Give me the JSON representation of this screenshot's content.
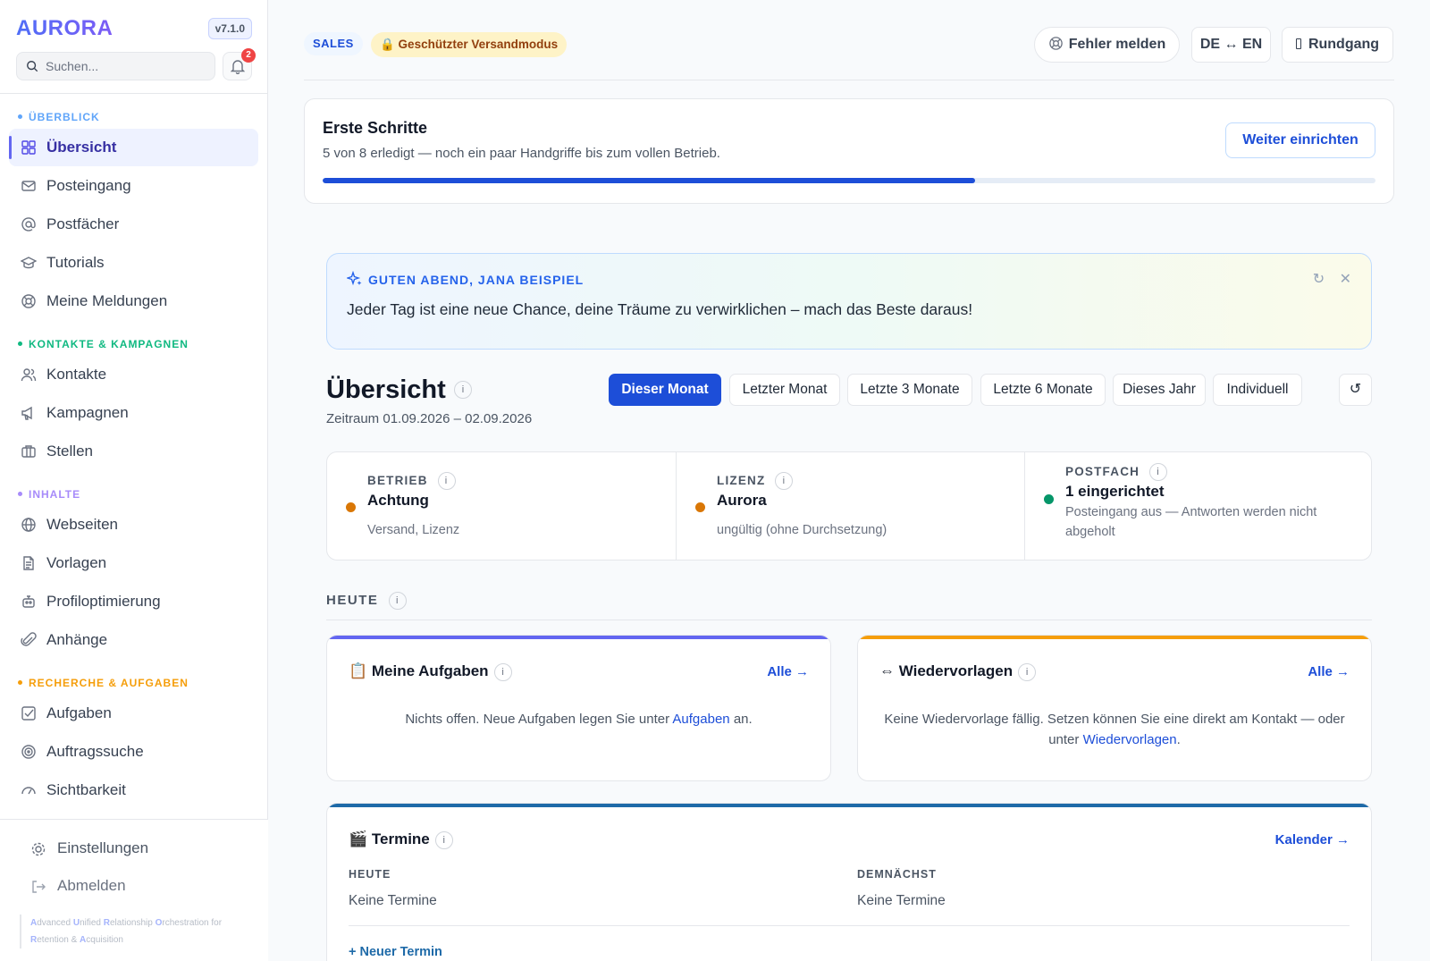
{
  "app": {
    "logo": "AURORA",
    "version": "v7.1.0"
  },
  "search": {
    "placeholder": "Suchen..."
  },
  "notifications": {
    "count": "2"
  },
  "sidebar": {
    "sections": [
      {
        "title": "ÜBERBLICK",
        "color": "#60a5fa",
        "items": [
          {
            "label": "Übersicht",
            "icon": "dashboard-icon",
            "active": true
          },
          {
            "label": "Posteingang",
            "icon": "mail-icon"
          },
          {
            "label": "Postfächer",
            "icon": "at-icon"
          },
          {
            "label": "Tutorials",
            "icon": "graduation-cap-icon"
          },
          {
            "label": "Meine Meldungen",
            "icon": "lifebuoy-icon"
          }
        ]
      },
      {
        "title": "KONTAKTE & KAMPAGNEN",
        "color": "#10b981",
        "items": [
          {
            "label": "Kontakte",
            "icon": "users-icon"
          },
          {
            "label": "Kampagnen",
            "icon": "megaphone-icon"
          },
          {
            "label": "Stellen",
            "icon": "briefcase-icon"
          }
        ]
      },
      {
        "title": "INHALTE",
        "color": "#a78bfa",
        "items": [
          {
            "label": "Webseiten",
            "icon": "globe-icon"
          },
          {
            "label": "Vorlagen",
            "icon": "document-icon"
          },
          {
            "label": "Profiloptimierung",
            "icon": "robot-icon"
          },
          {
            "label": "Anhänge",
            "icon": "paperclip-icon"
          }
        ]
      },
      {
        "title": "RECHERCHE & AUFGABEN",
        "color": "#f59e0b",
        "items": [
          {
            "label": "Aufgaben",
            "icon": "checkbox-icon"
          },
          {
            "label": "Auftragssuche",
            "icon": "target-icon"
          },
          {
            "label": "Sichtbarkeit",
            "icon": "gauge-icon"
          }
        ]
      }
    ],
    "bottom": [
      {
        "label": "Einstellungen",
        "icon": "gear-icon"
      },
      {
        "label": "Abmelden",
        "icon": "logout-icon"
      }
    ],
    "tagline": [
      "A",
      "dvanced ",
      "U",
      "nified ",
      "R",
      "elationship ",
      "O",
      "rchestration for ",
      "R",
      "etention & ",
      "A",
      "cquisition"
    ]
  },
  "topbar": {
    "badge_sales": "SALES",
    "badge_protected": "🔒 Geschützter Versandmodus",
    "report_error": "Fehler melden",
    "language": "DE ↔ EN",
    "tour": "Rundgang"
  },
  "onboarding": {
    "title": "Erste Schritte",
    "text": "5 von 8 erledigt — noch ein paar Handgriffe bis zum vollen Betrieb.",
    "button": "Weiter einrichten",
    "progress": 0.62
  },
  "greeting": {
    "heading": "GUTEN ABEND, JANA BEISPIEL",
    "message": "Jeder Tag ist eine neue Chance, deine Träume zu verwirklichen – mach das Beste daraus!",
    "refresh_icon": "↻",
    "close_icon": "✕"
  },
  "overview": {
    "title": "Übersicht",
    "info": "i",
    "period": "Zeitraum 01.09.2026 – 02.09.2026",
    "ranges": [
      "Dieser Monat",
      "Letzter Monat",
      "Letzte 3 Monate",
      "Letzte 6 Monate",
      "Dieses Jahr",
      "Individuell"
    ],
    "active_range": 0,
    "reset": "↺"
  },
  "status": [
    {
      "key": "BETRIEB",
      "value": "Achtung",
      "sub": "Versand, Lizenz",
      "color": "#d97706"
    },
    {
      "key": "LIZENZ",
      "value": "Aurora",
      "sub": "ungültig (ohne Durchsetzung)",
      "color": "#d97706"
    },
    {
      "key": "POSTFACH",
      "value": "1 eingerichtet",
      "sub": "Posteingang aus — Antworten werden nicht abgeholt",
      "color": "#059669"
    }
  ],
  "today": {
    "title": "HEUTE",
    "tasks": {
      "title": "📋 Meine Aufgaben",
      "all": "Alle →",
      "text_a": "Nichts offen. Neue Aufgaben legen Sie unter ",
      "link": "Aufgaben",
      "text_b": " an.",
      "color": "#6366f1"
    },
    "followups": {
      "title": "⇔ Wiedervorlagen",
      "all": "Alle →",
      "text_a": "Keine Wiedervorlage fällig. Setzen können Sie eine direkt am Kontakt — oder unter ",
      "link": "Wiedervorlagen",
      "text_b": ".",
      "color": "#f59e0b"
    },
    "appointments": {
      "title": "🎬 Termine",
      "calendar": "Kalender →",
      "col_today": "HEUTE",
      "col_soon": "DEMNÄCHST",
      "today_value": "Keine Termine",
      "soon_value": "Keine Termine",
      "new": "+ Neuer Termin"
    }
  }
}
